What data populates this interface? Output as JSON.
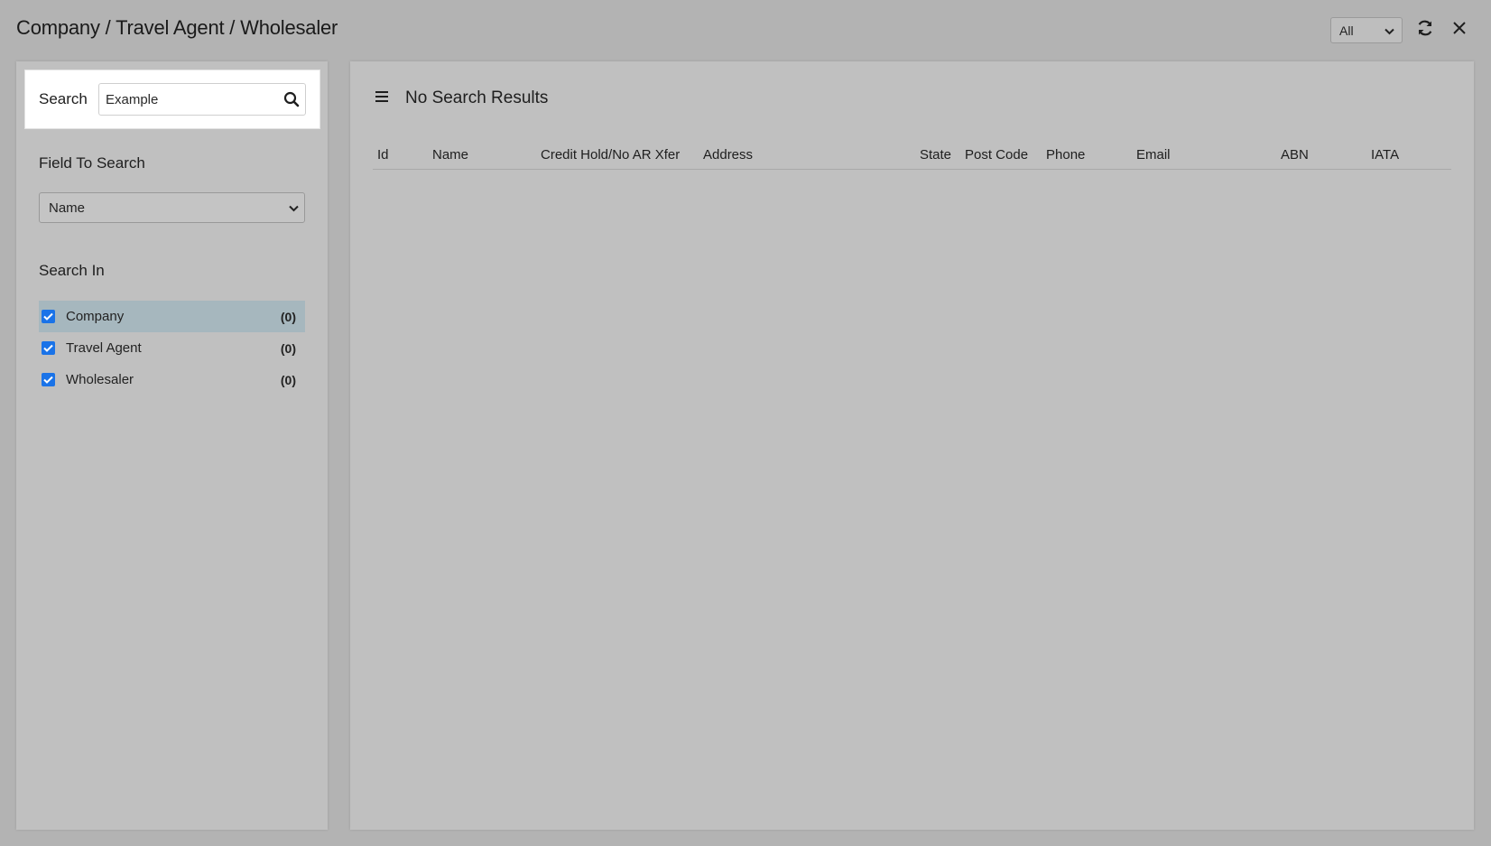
{
  "window": {
    "title": "Company / Travel Agent / Wholesaler",
    "scope_value": "All"
  },
  "sidebar": {
    "search_label": "Search",
    "search_value": "Example",
    "field_to_search_heading": "Field To Search",
    "field_to_search_value": "Name",
    "search_in_heading": "Search In",
    "search_in_items": [
      {
        "label": "Company",
        "count": "(0)",
        "checked": true
      },
      {
        "label": "Travel Agent",
        "count": "(0)",
        "checked": true
      },
      {
        "label": "Wholesaler",
        "count": "(0)",
        "checked": true
      }
    ]
  },
  "results": {
    "title": "No Search Results",
    "columns": [
      "Id",
      "Name",
      "Credit Hold/No AR Xfer",
      "Address",
      "State",
      "Post Code",
      "Phone",
      "Email",
      "ABN",
      "IATA"
    ]
  },
  "colors": {
    "background": "#b3b3b3",
    "panel": "#c0c0c0",
    "checkbox": "#1a73e8",
    "selected_row": "#a6b7be"
  }
}
